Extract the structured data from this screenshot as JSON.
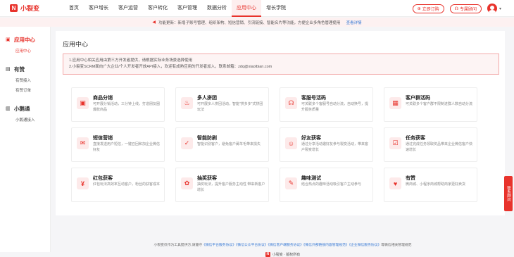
{
  "brand": {
    "name": "小裂变",
    "mark": "N"
  },
  "nav": {
    "items": [
      "首页",
      "客户增长",
      "客户运营",
      "客户转化",
      "客户管理",
      "数据分析",
      "应用中心",
      "增长学院"
    ],
    "active_index": 6
  },
  "topright": {
    "order_label": "立即订购",
    "service_label": "专属顾问"
  },
  "notice": {
    "text": "功能更新：新增子账号管理、组织架构、短信营销、引流链接、智能名片等功能，方便企业多角色管理使用",
    "link": "查看详情"
  },
  "sidebar": {
    "groups": [
      {
        "title": "应用中心",
        "active": true,
        "items": [
          "应用中心"
        ],
        "active_item": 0
      },
      {
        "title": "有赞",
        "active": false,
        "items": [
          "有赞接入",
          "有赞订单"
        ]
      },
      {
        "title": "小鹅通",
        "active": false,
        "items": [
          "小鹅通接入"
        ]
      }
    ]
  },
  "page": {
    "title": "应用中心",
    "alert_lines": [
      "1.应用中心相关应用由第三方开发者提供，请根据实际业务场景选择使用",
      "2.小裂变SCRM面向广大企业/个人开发者开放API接入，欢迎有成熟应用的开发者加入，联系邮箱：zdq@xiaolbian.com"
    ]
  },
  "apps": [
    {
      "title": "商品分销",
      "desc": "可开展分销活动，三分钟上线，打造朋友圈爆款商品",
      "icon": "shopping-bag-icon",
      "glyph": "▣"
    },
    {
      "title": "多人拼团",
      "desc": "可开展多人拼团活动，智能“拼多多”式拼团玩法",
      "icon": "group-buy-icon",
      "glyph": "♨"
    },
    {
      "title": "客服号活码",
      "desc": "可关联多个客服号自动分流，自动换号，提升服务质量",
      "icon": "headset-icon",
      "glyph": "☊"
    },
    {
      "title": "客户群活码",
      "desc": "可关联多个客户群不限制进群人数自动分流",
      "icon": "group-qrcode-icon",
      "glyph": "▦"
    },
    {
      "title": "短信营销",
      "desc": "直接发送用户短信，一键召回和加企业微信好友",
      "icon": "sms-icon",
      "glyph": "✉"
    },
    {
      "title": "智能防刷",
      "desc": "智能识别客户，避免客户薅羊毛带来损失",
      "icon": "shield-icon",
      "glyph": "✓"
    },
    {
      "title": "好友获客",
      "desc": "通过分享活动邀好友参与裂变活动，带来客户裂变增长",
      "icon": "user-add-icon",
      "glyph": "☺"
    },
    {
      "title": "任务获客",
      "desc": "通过完成任务领取奖品带来企业微信客户快速增长",
      "icon": "task-icon",
      "glyph": "☑"
    },
    {
      "title": "红包获客",
      "desc": "红包玩法高效率互动客户，粉丝的获客成本",
      "icon": "red-packet-icon",
      "glyph": "¥"
    },
    {
      "title": "抽奖获客",
      "desc": "抽奖玩法，提升客户服务主动性 带来新客户增长",
      "icon": "lottery-icon",
      "glyph": "✿"
    },
    {
      "title": "趣味测试",
      "desc": "结合热点的趣味活动吸引客户主动参与",
      "icon": "quiz-icon",
      "glyph": "✎"
    },
    {
      "title": "有赞",
      "desc": "微商城、小程序商城帮助商家更好卖货",
      "icon": "youzan-icon",
      "glyph": "♥"
    }
  ],
  "footer": {
    "prefix": "小裂变仅作为工具提供方,请遵守",
    "links": [
      "《微信平台服务协议》",
      "《微信公众平台协议》",
      "《微信客户端服务协议》",
      "《微信外部链接内容管理规范》",
      "《企业微信服务协议》"
    ],
    "suffix": "等微信相关管理规范",
    "copyright": "小裂变 · 版权所有"
  },
  "float_contact": "联系顾问",
  "colors": {
    "accent": "#e8332c",
    "link": "#3a7bd5",
    "notice_bg": "#fdf1f1"
  }
}
